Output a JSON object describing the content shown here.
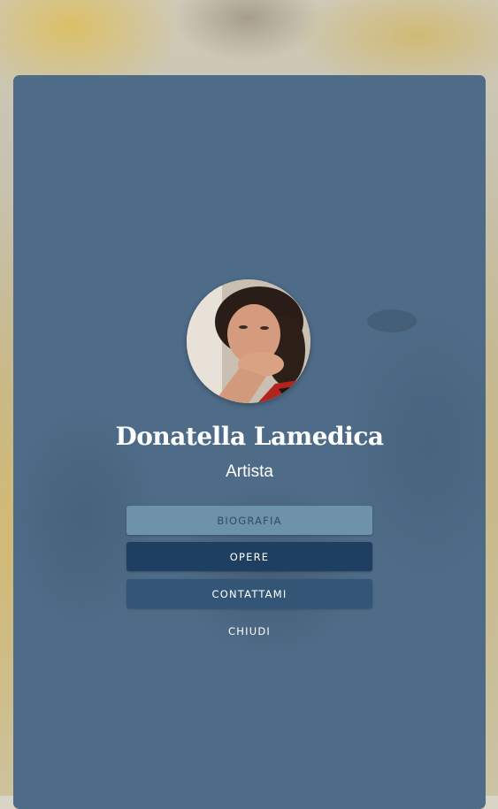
{
  "profile": {
    "name": "Donatella Lamedica",
    "role": "Artista"
  },
  "menu": {
    "biografia": "BIOGRAFIA",
    "opere": "OPERE",
    "contattami": "CONTATTAMI",
    "chiudi": "CHIUDI"
  },
  "colors": {
    "card": "#4e6b87",
    "button_active": "#6e92a9",
    "button_primary": "#1f3f62",
    "button_secondary": "#335676"
  }
}
